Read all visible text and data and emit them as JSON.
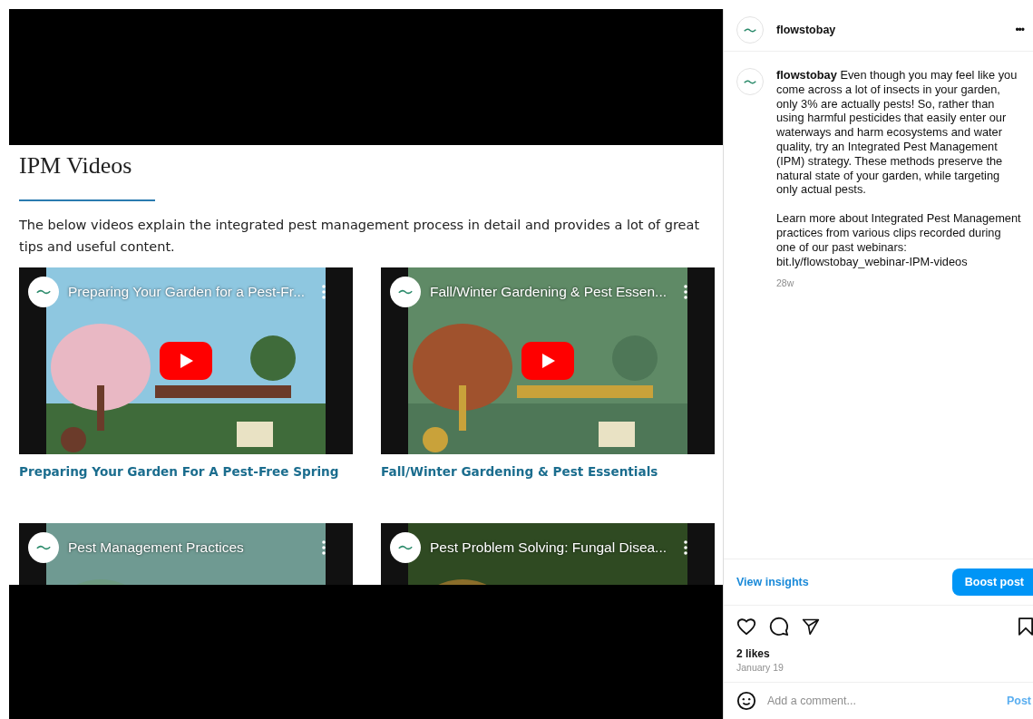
{
  "post_image": {
    "heading": "IPM Videos",
    "intro": "The below videos explain the integrated pest management process in detail and provides a lot of great tips and useful content.",
    "videos": [
      {
        "overlay_title": "Preparing Your Garden for a Pest-Fr...",
        "caption": "Preparing Your Garden For A Pest-Free Spring"
      },
      {
        "overlay_title": "Fall/Winter Gardening & Pest Essen...",
        "caption": "Fall/Winter Gardening & Pest Essentials"
      },
      {
        "overlay_title": "Pest Management Practices"
      },
      {
        "overlay_title": "Pest Problem Solving: Fungal Disea..."
      }
    ]
  },
  "sidebar": {
    "header": {
      "username": "flowstobay",
      "more": "•••"
    },
    "caption": {
      "paragraphs": [
        "**flowstobay** Even though you may feel like you come across a lot of insects in your garden, only 3% are actually pests! So, rather than using harmful pesticides that easily enter our waterways and harm ecosystems and water quality, try an Integrated Pest Management (IPM) strategy. These methods preserve the natural state of your garden, while targeting only actual pests.",
        "Learn more about Integrated Pest Management practices from various clips recorded during one of our past webinars: bit.ly/flowstobay_webinar-IPM-videos"
      ],
      "time": "28w"
    },
    "insights_link": "View insights",
    "boost_button": "Boost post",
    "likes": "2 likes",
    "date": "January 19",
    "comment": {
      "placeholder": "Add a comment...",
      "post_button": "Post",
      "post_disabled": true
    }
  }
}
